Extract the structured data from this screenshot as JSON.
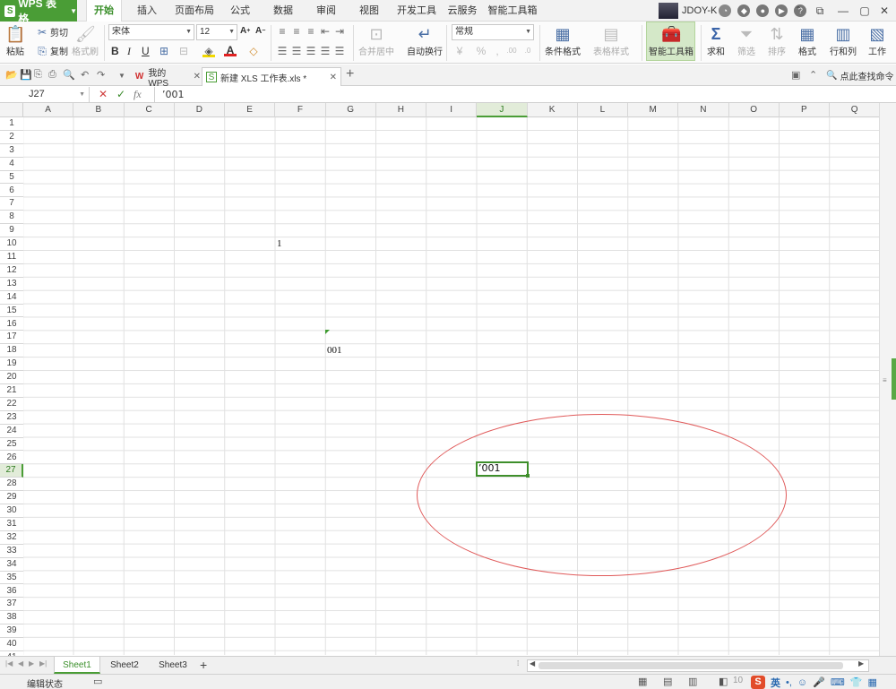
{
  "app": {
    "name": "WPS 表格",
    "logo": "S"
  },
  "menu": {
    "tabs": [
      "开始",
      "插入",
      "页面布局",
      "公式",
      "数据",
      "审阅",
      "视图",
      "开发工具",
      "云服务",
      "智能工具箱"
    ],
    "active": "开始"
  },
  "user": {
    "name": "JDOY-K"
  },
  "ribbon": {
    "paste": "粘贴",
    "cut": "剪切",
    "copy": "复制",
    "format_painter": "格式刷",
    "font_name": "宋体",
    "font_size": "12",
    "merge_center": "合并居中",
    "wrap_text": "自动换行",
    "number_format": "常规",
    "conditional_format": "条件格式",
    "table_style": "表格样式",
    "smart_toolbox": "智能工具箱",
    "sum": "求和",
    "filter": "筛选",
    "sort": "排序",
    "format": "格式",
    "rows_cols": "行和列",
    "worksheet": "工作"
  },
  "docbar": {
    "tabs": [
      {
        "label": "我的WPS",
        "active": false
      },
      {
        "label": "新建 XLS 工作表.xls *",
        "active": true
      }
    ],
    "search_label": "点此查找命令"
  },
  "formula_bar": {
    "name_box": "J27",
    "cancel": "✕",
    "confirm": "✓",
    "fx": "fx",
    "content": "’001"
  },
  "grid": {
    "columns": [
      "A",
      "B",
      "C",
      "D",
      "E",
      "F",
      "G",
      "H",
      "I",
      "J",
      "K",
      "L",
      "M",
      "N",
      "O",
      "P",
      "Q"
    ],
    "selected_column": "J",
    "row_count": 41,
    "selected_row": 27,
    "cells": [
      {
        "ref": "F9",
        "value": "1"
      },
      {
        "ref": "G17",
        "value": "001"
      }
    ],
    "active_cell": {
      "ref": "J27",
      "value": "’001"
    }
  },
  "sheets": {
    "tabs": [
      "Sheet1",
      "Sheet2",
      "Sheet3"
    ],
    "active": "Sheet1",
    "add": "+"
  },
  "status": {
    "text": "编辑状态",
    "zoom": "10",
    "ime_lang": "英"
  },
  "colors": {
    "accent": "#4a9d36",
    "annotation": "#e05a5a"
  }
}
